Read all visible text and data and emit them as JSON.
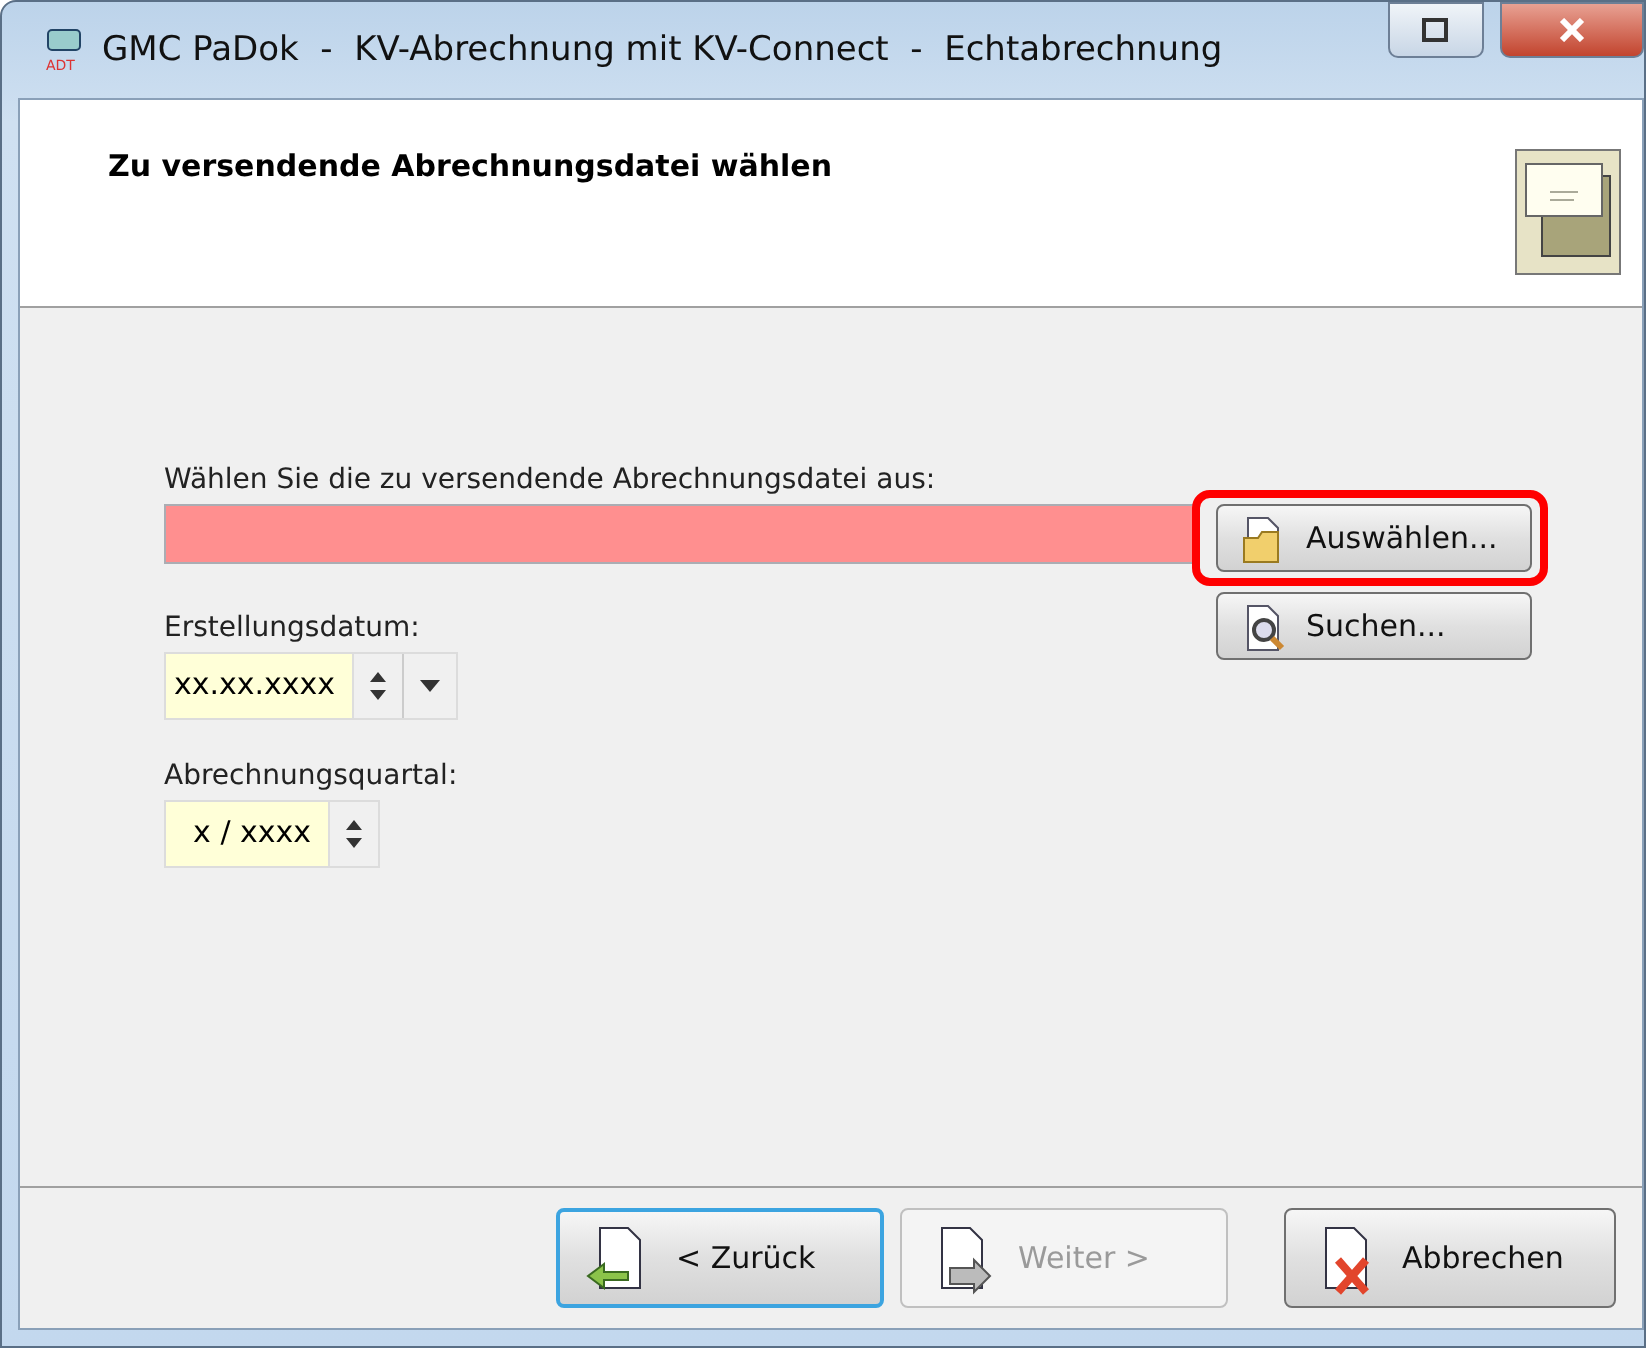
{
  "window": {
    "icon_text": "ADT",
    "title": "GMC PaDok  -  KV-Abrechnung mit KV-Connect  -  Echtabrechnung"
  },
  "header": {
    "title": "Zu versendende Abrechnungsdatei wählen"
  },
  "file": {
    "label": "Wählen Sie die zu versendende Abrechnungsdatei aus:",
    "invalid": true
  },
  "side_buttons": [
    {
      "label": "Auswählen...",
      "kind": "open",
      "highlighted": true
    },
    {
      "label": "Suchen...",
      "kind": "search",
      "highlighted": false
    }
  ],
  "date": {
    "label": "Erstellungsdatum:",
    "value": "xx.xx.xxxx"
  },
  "quarter": {
    "label": "Abrechnungsquartal:",
    "value": "x / xxxx"
  },
  "footer_buttons": [
    {
      "label": "< Zurück",
      "kind": "back",
      "disabled": false,
      "focused": true
    },
    {
      "label": "Weiter >",
      "kind": "next",
      "disabled": true,
      "focused": false
    },
    {
      "label": "Abbrechen",
      "kind": "cancel",
      "disabled": false,
      "focused": false
    }
  ]
}
